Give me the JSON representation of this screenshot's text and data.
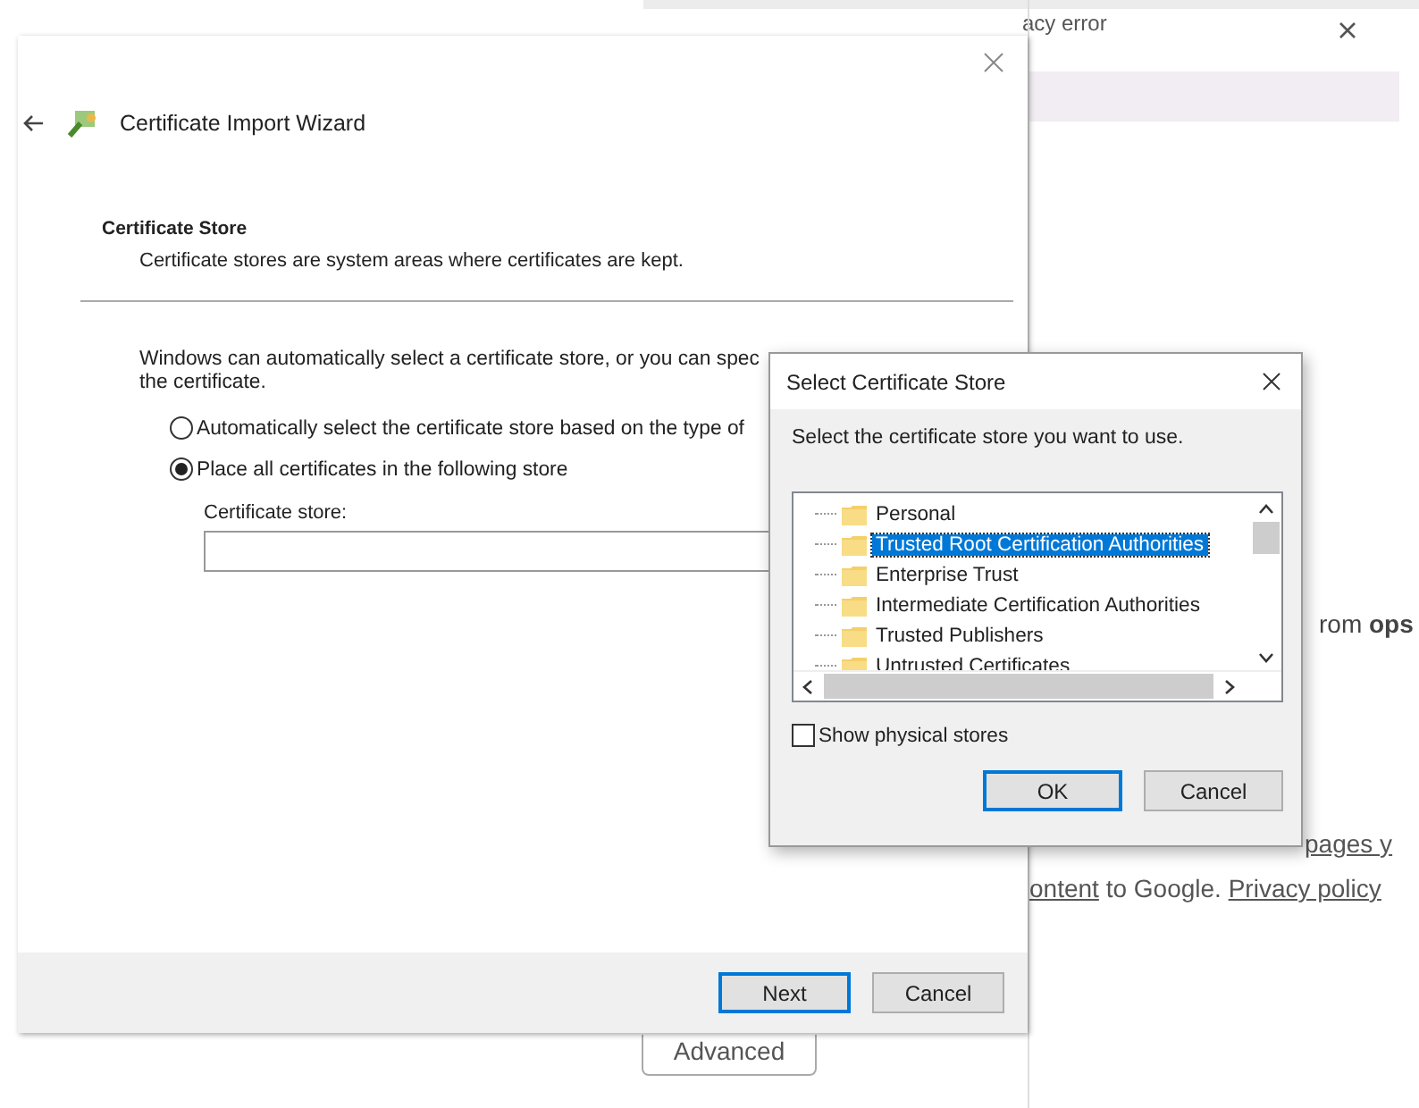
{
  "browser_page": {
    "tab_title": "acy error",
    "text_line_1": "rom **ops**",
    "text_line_2": "pages y",
    "text_line_3": [
      {
        "kind": "link",
        "text": "ontent"
      },
      {
        "kind": "text",
        "text": " to Google. "
      },
      {
        "kind": "link",
        "text": "Privacy policy"
      }
    ],
    "advanced_button": "Advanced"
  },
  "wizard": {
    "title": "Certificate Import Wizard",
    "section_title": "Certificate Store",
    "section_description": "Certificate stores are system areas where certificates are kept.",
    "intro_lines": [
      "Windows can automatically select a certificate store, or you can spec",
      "the certificate."
    ],
    "options": [
      {
        "label": "Automatically select the certificate store based on the type of",
        "selected": false
      },
      {
        "label": "Place all certificates in the following store",
        "selected": true
      }
    ],
    "store_label": "Certificate store:",
    "buttons": [
      {
        "label": "Next",
        "default": true
      },
      {
        "label": "Cancel",
        "default": false
      }
    ]
  },
  "dialog": {
    "title": "Select Certificate Store",
    "prompt": "Select the certificate store you want to use.",
    "stores": [
      {
        "label": "Personal",
        "selected": false
      },
      {
        "label": "Trusted Root Certification Authorities",
        "selected": true
      },
      {
        "label": "Enterprise Trust",
        "selected": false
      },
      {
        "label": "Intermediate Certification Authorities",
        "selected": false
      },
      {
        "label": "Trusted Publishers",
        "selected": false
      },
      {
        "label": "Untrusted Certificates",
        "selected": false
      }
    ],
    "show_physical_stores": {
      "label": "Show physical stores",
      "checked": false
    },
    "buttons": [
      {
        "label": "OK",
        "default": true
      },
      {
        "label": "Cancel",
        "default": false
      }
    ]
  }
}
